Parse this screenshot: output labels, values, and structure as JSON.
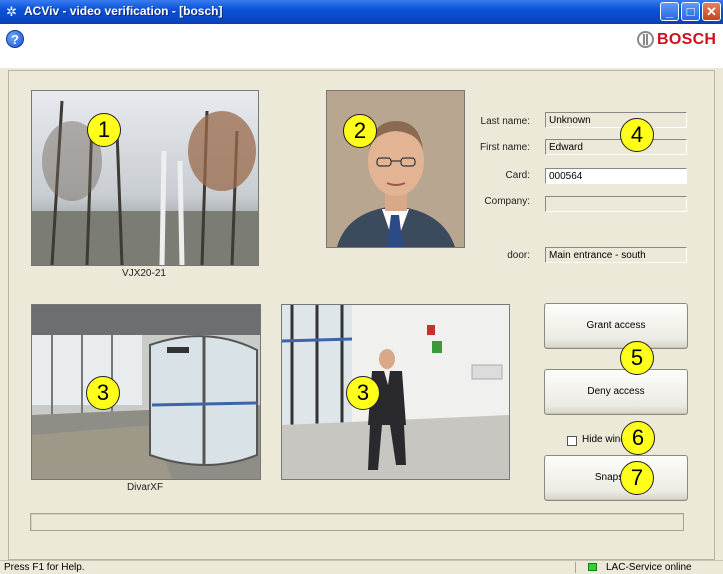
{
  "window": {
    "title": "ACViv - video verification - [bosch]",
    "controls": [
      "minimize",
      "maximize",
      "close"
    ]
  },
  "toolbar": {
    "help_icon": "help-icon",
    "brand": "BOSCH",
    "brand_color": "#d0101a"
  },
  "cameras": {
    "top_caption": "VJX20-21",
    "bottom_left_caption": "DivarXF"
  },
  "person": {
    "last_name_label": "Last name:",
    "last_name": "Unknown",
    "first_name_label": "First name:",
    "first_name": "Edward",
    "card_label": "Card:",
    "card": "000564",
    "company_label": "Company:",
    "company": "",
    "door_label": "door:",
    "door": "Main entrance - south"
  },
  "actions": {
    "grant": "Grant access",
    "deny": "Deny access",
    "hide_window": "Hide window",
    "snapshot": "Snapshot"
  },
  "callouts": [
    "1",
    "2",
    "3",
    "3",
    "4",
    "5",
    "6",
    "7"
  ],
  "status": {
    "help_text": "Press F1 for Help.",
    "service": "LAC-Service online",
    "service_color": "#2fd52f"
  }
}
